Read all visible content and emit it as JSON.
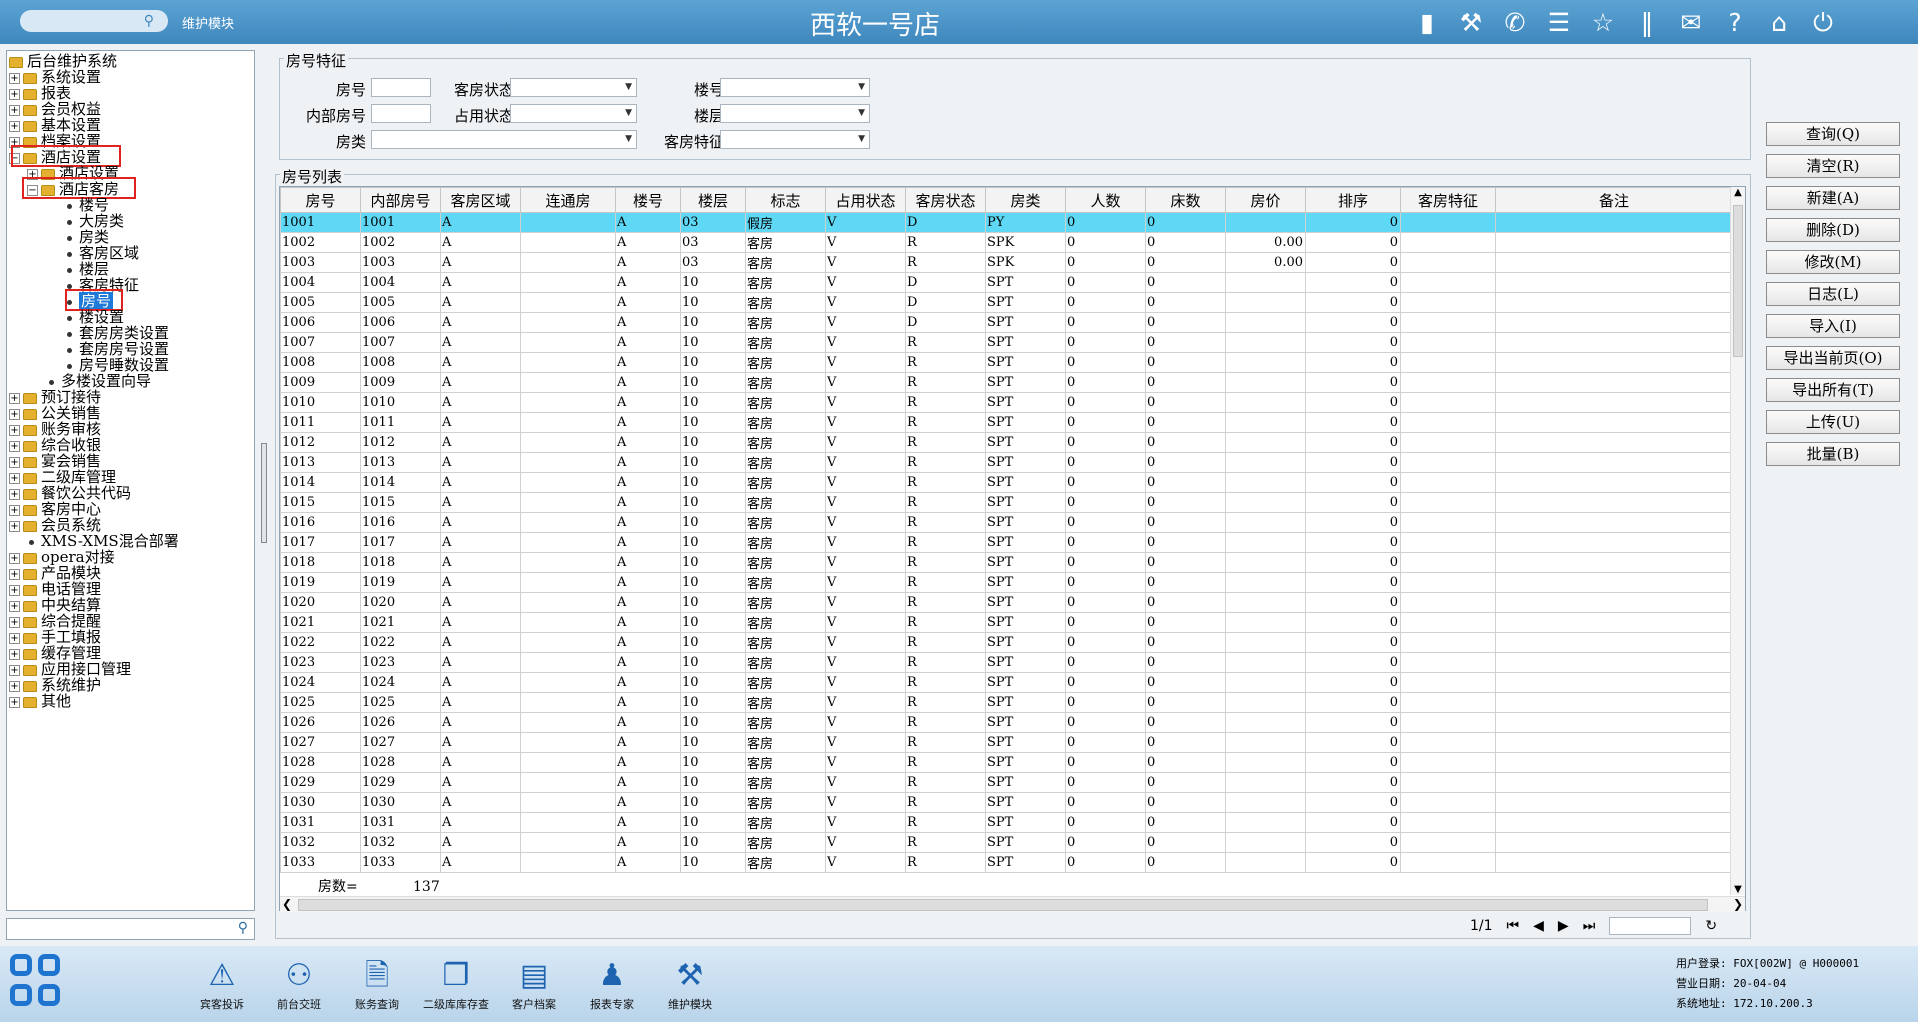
{
  "header": {
    "search_placeholder": "",
    "module_label": "维护模块",
    "title": "西软一号店",
    "icons": [
      "signal-icon",
      "tools-icon",
      "phone-icon",
      "menu-icon",
      "star-icon",
      "columns-icon",
      "mail-icon",
      "help-icon",
      "home-icon",
      "power-icon"
    ]
  },
  "tree": {
    "root": "后台维护系统",
    "items": [
      "系统设置",
      "报表",
      "会员权益",
      "基本设置",
      "档案设置",
      "酒店设置",
      "酒店设置",
      "酒店客房",
      "楼号",
      "大房类",
      "房类",
      "客房区域",
      "楼层",
      "客房特征",
      "房号",
      "楼设置",
      "套房房类设置",
      "套房房号设置",
      "房号睡数设置",
      "多楼设置向导",
      "预订接待",
      "公关销售",
      "账务审核",
      "综合收银",
      "宴会销售",
      "二级库管理",
      "餐饮公共代码",
      "客房中心",
      "会员系统",
      "XMS-XMS混合部署",
      "opera对接",
      "产品模块",
      "电话管理",
      "中央结算",
      "综合提醒",
      "手工填报",
      "缓存管理",
      "应用接口管理",
      "系统维护",
      "其他"
    ]
  },
  "features": {
    "title": "房号特征",
    "room_no_label": "房号",
    "room_status_label": "客房状态",
    "building_label": "楼号",
    "inner_no_label": "内部房号",
    "occ_status_label": "占用状态",
    "floor_label": "楼层",
    "room_type_label": "房类",
    "room_feature_label": "客房特征"
  },
  "list": {
    "title": "房号列表",
    "columns": [
      "房号",
      "内部房号",
      "客房区域",
      "连通房",
      "楼号",
      "楼层",
      "标志",
      "占用状态",
      "客房状态",
      "房类",
      "人数",
      "床数",
      "房价",
      "排序",
      "客房特征",
      "备注"
    ],
    "rows": [
      [
        "1001",
        "1001",
        "A",
        "",
        "A",
        "03",
        "假房",
        "V",
        "D",
        "PY",
        "0",
        "0",
        "",
        "0",
        "",
        ""
      ],
      [
        "1002",
        "1002",
        "A",
        "",
        "A",
        "03",
        "客房",
        "V",
        "R",
        "SPK",
        "0",
        "0",
        "0.00",
        "0",
        "",
        ""
      ],
      [
        "1003",
        "1003",
        "A",
        "",
        "A",
        "03",
        "客房",
        "V",
        "R",
        "SPK",
        "0",
        "0",
        "0.00",
        "0",
        "",
        ""
      ],
      [
        "1004",
        "1004",
        "A",
        "",
        "A",
        "10",
        "客房",
        "V",
        "D",
        "SPT",
        "0",
        "0",
        "",
        "0",
        "",
        ""
      ],
      [
        "1005",
        "1005",
        "A",
        "",
        "A",
        "10",
        "客房",
        "V",
        "D",
        "SPT",
        "0",
        "0",
        "",
        "0",
        "",
        ""
      ],
      [
        "1006",
        "1006",
        "A",
        "",
        "A",
        "10",
        "客房",
        "V",
        "D",
        "SPT",
        "0",
        "0",
        "",
        "0",
        "",
        ""
      ],
      [
        "1007",
        "1007",
        "A",
        "",
        "A",
        "10",
        "客房",
        "V",
        "R",
        "SPT",
        "0",
        "0",
        "",
        "0",
        "",
        ""
      ],
      [
        "1008",
        "1008",
        "A",
        "",
        "A",
        "10",
        "客房",
        "V",
        "R",
        "SPT",
        "0",
        "0",
        "",
        "0",
        "",
        ""
      ],
      [
        "1009",
        "1009",
        "A",
        "",
        "A",
        "10",
        "客房",
        "V",
        "R",
        "SPT",
        "0",
        "0",
        "",
        "0",
        "",
        ""
      ],
      [
        "1010",
        "1010",
        "A",
        "",
        "A",
        "10",
        "客房",
        "V",
        "R",
        "SPT",
        "0",
        "0",
        "",
        "0",
        "",
        ""
      ],
      [
        "1011",
        "1011",
        "A",
        "",
        "A",
        "10",
        "客房",
        "V",
        "R",
        "SPT",
        "0",
        "0",
        "",
        "0",
        "",
        ""
      ],
      [
        "1012",
        "1012",
        "A",
        "",
        "A",
        "10",
        "客房",
        "V",
        "R",
        "SPT",
        "0",
        "0",
        "",
        "0",
        "",
        ""
      ],
      [
        "1013",
        "1013",
        "A",
        "",
        "A",
        "10",
        "客房",
        "V",
        "R",
        "SPT",
        "0",
        "0",
        "",
        "0",
        "",
        ""
      ],
      [
        "1014",
        "1014",
        "A",
        "",
        "A",
        "10",
        "客房",
        "V",
        "R",
        "SPT",
        "0",
        "0",
        "",
        "0",
        "",
        ""
      ],
      [
        "1015",
        "1015",
        "A",
        "",
        "A",
        "10",
        "客房",
        "V",
        "R",
        "SPT",
        "0",
        "0",
        "",
        "0",
        "",
        ""
      ],
      [
        "1016",
        "1016",
        "A",
        "",
        "A",
        "10",
        "客房",
        "V",
        "R",
        "SPT",
        "0",
        "0",
        "",
        "0",
        "",
        ""
      ],
      [
        "1017",
        "1017",
        "A",
        "",
        "A",
        "10",
        "客房",
        "V",
        "R",
        "SPT",
        "0",
        "0",
        "",
        "0",
        "",
        ""
      ],
      [
        "1018",
        "1018",
        "A",
        "",
        "A",
        "10",
        "客房",
        "V",
        "R",
        "SPT",
        "0",
        "0",
        "",
        "0",
        "",
        ""
      ],
      [
        "1019",
        "1019",
        "A",
        "",
        "A",
        "10",
        "客房",
        "V",
        "R",
        "SPT",
        "0",
        "0",
        "",
        "0",
        "",
        ""
      ],
      [
        "1020",
        "1020",
        "A",
        "",
        "A",
        "10",
        "客房",
        "V",
        "R",
        "SPT",
        "0",
        "0",
        "",
        "0",
        "",
        ""
      ],
      [
        "1021",
        "1021",
        "A",
        "",
        "A",
        "10",
        "客房",
        "V",
        "R",
        "SPT",
        "0",
        "0",
        "",
        "0",
        "",
        ""
      ],
      [
        "1022",
        "1022",
        "A",
        "",
        "A",
        "10",
        "客房",
        "V",
        "R",
        "SPT",
        "0",
        "0",
        "",
        "0",
        "",
        ""
      ],
      [
        "1023",
        "1023",
        "A",
        "",
        "A",
        "10",
        "客房",
        "V",
        "R",
        "SPT",
        "0",
        "0",
        "",
        "0",
        "",
        ""
      ],
      [
        "1024",
        "1024",
        "A",
        "",
        "A",
        "10",
        "客房",
        "V",
        "R",
        "SPT",
        "0",
        "0",
        "",
        "0",
        "",
        ""
      ],
      [
        "1025",
        "1025",
        "A",
        "",
        "A",
        "10",
        "客房",
        "V",
        "R",
        "SPT",
        "0",
        "0",
        "",
        "0",
        "",
        ""
      ],
      [
        "1026",
        "1026",
        "A",
        "",
        "A",
        "10",
        "客房",
        "V",
        "R",
        "SPT",
        "0",
        "0",
        "",
        "0",
        "",
        ""
      ],
      [
        "1027",
        "1027",
        "A",
        "",
        "A",
        "10",
        "客房",
        "V",
        "R",
        "SPT",
        "0",
        "0",
        "",
        "0",
        "",
        ""
      ],
      [
        "1028",
        "1028",
        "A",
        "",
        "A",
        "10",
        "客房",
        "V",
        "R",
        "SPT",
        "0",
        "0",
        "",
        "0",
        "",
        ""
      ],
      [
        "1029",
        "1029",
        "A",
        "",
        "A",
        "10",
        "客房",
        "V",
        "R",
        "SPT",
        "0",
        "0",
        "",
        "0",
        "",
        ""
      ],
      [
        "1030",
        "1030",
        "A",
        "",
        "A",
        "10",
        "客房",
        "V",
        "R",
        "SPT",
        "0",
        "0",
        "",
        "0",
        "",
        ""
      ],
      [
        "1031",
        "1031",
        "A",
        "",
        "A",
        "10",
        "客房",
        "V",
        "R",
        "SPT",
        "0",
        "0",
        "",
        "0",
        "",
        ""
      ],
      [
        "1032",
        "1032",
        "A",
        "",
        "A",
        "10",
        "客房",
        "V",
        "R",
        "SPT",
        "0",
        "0",
        "",
        "0",
        "",
        ""
      ],
      [
        "1033",
        "1033",
        "A",
        "",
        "A",
        "10",
        "客房",
        "V",
        "R",
        "SPT",
        "0",
        "0",
        "",
        "0",
        "",
        ""
      ]
    ],
    "count_label": "房数=",
    "count_value": "137",
    "page_info": "1/1"
  },
  "buttons": [
    "查询(Q)",
    "清空(R)",
    "新建(A)",
    "删除(D)",
    "修改(M)",
    "日志(L)",
    "导入(I)",
    "导出当前页(O)",
    "导出所有(T)",
    "上传(U)",
    "批量(B)"
  ],
  "bottom": {
    "items": [
      "宾客投诉",
      "前台交班",
      "账务查询",
      "二级库库存查",
      "客户档案",
      "报表专家",
      "维护模块"
    ],
    "user_login": "用户登录: FOX[002W] @ H000001",
    "business_date": "营业日期: 20-04-04",
    "system_address": "系统地址: 172.10.200.3"
  }
}
